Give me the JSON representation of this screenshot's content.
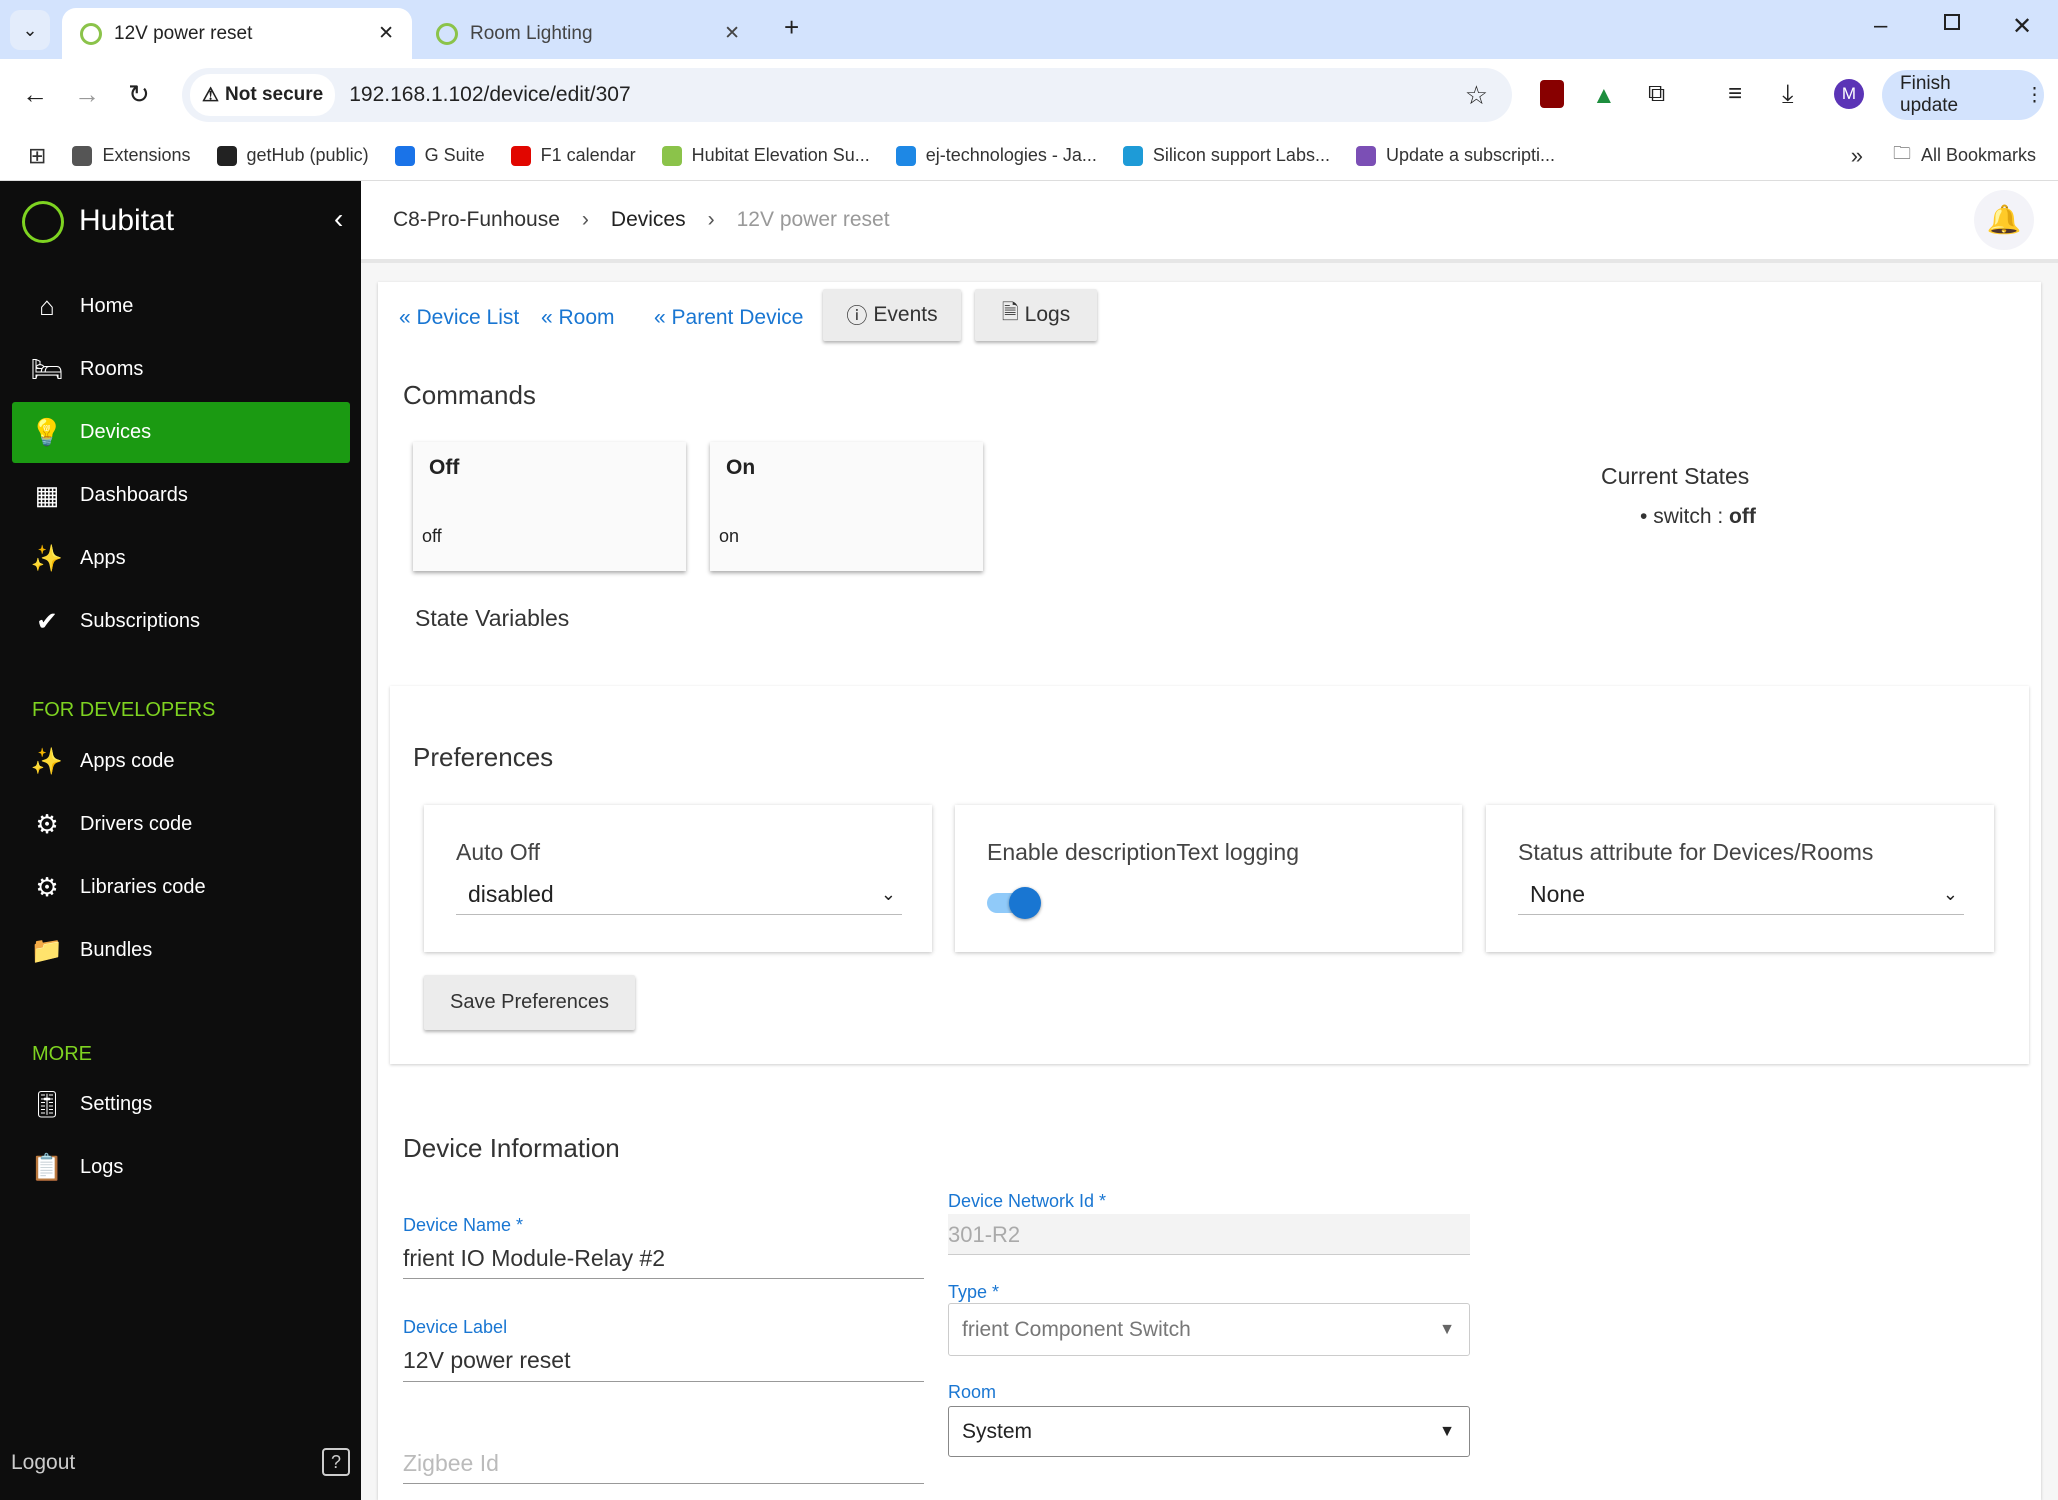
{
  "browser": {
    "tabs": [
      {
        "title": "12V power reset",
        "active": true
      },
      {
        "title": "Room Lighting",
        "active": false
      }
    ],
    "security": "Not secure",
    "url": "192.168.1.102/device/edit/307",
    "profile_initial": "M",
    "finish_update": "Finish update",
    "bookmarks": [
      {
        "label": "Extensions",
        "color": "#555"
      },
      {
        "label": "getHub (public)",
        "color": "#222"
      },
      {
        "label": "G Suite",
        "color": "#1a73e8"
      },
      {
        "label": "F1 calendar",
        "color": "#e10600"
      },
      {
        "label": "Hubitat Elevation Su...",
        "color": "#8bc34a"
      },
      {
        "label": "ej-technologies - Ja...",
        "color": "#1e88e5"
      },
      {
        "label": "Silicon support Labs...",
        "color": "#1e9bd7"
      },
      {
        "label": "Update a subscripti...",
        "color": "#7b4fb5"
      }
    ],
    "all_bookmarks": "All Bookmarks"
  },
  "sidebar": {
    "brand": "Hubitat",
    "items": [
      {
        "label": "Home",
        "icon": "⌂"
      },
      {
        "label": "Rooms",
        "icon": "🛏"
      },
      {
        "label": "Devices",
        "icon": "💡",
        "selected": true
      },
      {
        "label": "Dashboards",
        "icon": "▦"
      },
      {
        "label": "Apps",
        "icon": "✨"
      },
      {
        "label": "Subscriptions",
        "icon": "✔"
      }
    ],
    "dev_heading": "FOR DEVELOPERS",
    "dev_items": [
      {
        "label": "Apps code",
        "icon": "✨"
      },
      {
        "label": "Drivers code",
        "icon": "⚙"
      },
      {
        "label": "Libraries code",
        "icon": "⚙"
      },
      {
        "label": "Bundles",
        "icon": "📁"
      }
    ],
    "more_heading": "MORE",
    "more_items": [
      {
        "label": "Settings",
        "icon": "🎚"
      },
      {
        "label": "Logs",
        "icon": "📋"
      }
    ],
    "logout": "Logout",
    "help": "?",
    "accent": "#1b9a12"
  },
  "breadcrumb": {
    "hub": "C8-Pro-Funhouse",
    "section": "Devices",
    "current": "12V power reset"
  },
  "nav_links": {
    "device_list": "« Device List",
    "room": "« Room",
    "parent": "« Parent Device",
    "events": "Events",
    "logs": "Logs"
  },
  "commands": {
    "title": "Commands",
    "items": [
      {
        "name": "Off",
        "sub": "off"
      },
      {
        "name": "On",
        "sub": "on"
      }
    ]
  },
  "current_states": {
    "title": "Current States",
    "key": "switch : ",
    "value": "off"
  },
  "state_variables": "State Variables",
  "preferences": {
    "title": "Preferences",
    "auto_off": {
      "label": "Auto Off",
      "value": "disabled"
    },
    "desc_logging": {
      "label": "Enable descriptionText logging",
      "enabled": true
    },
    "status_attr": {
      "label": "Status attribute for Devices/Rooms",
      "value": "None"
    },
    "save": "Save Preferences"
  },
  "device_info": {
    "title": "Device Information",
    "name_label": "Device Name *",
    "name": "frient IO Module-Relay #2",
    "label_label": "Device Label",
    "label": "12V power reset",
    "zigbee_placeholder": "Zigbee Id",
    "dni_label": "Device Network Id *",
    "dni": "301-R2",
    "type_label": "Type *",
    "type": "frient Component Switch",
    "room_label": "Room",
    "room": "System"
  }
}
